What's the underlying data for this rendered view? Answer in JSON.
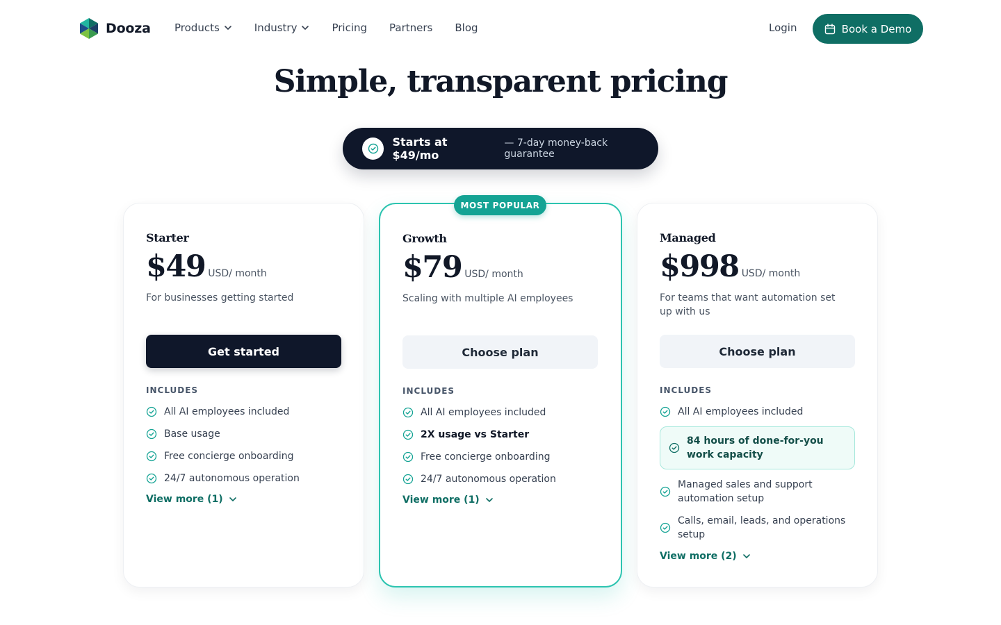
{
  "nav": {
    "brand": "Dooza",
    "links": [
      {
        "label": "Products",
        "dropdown": true
      },
      {
        "label": "Industry",
        "dropdown": true
      },
      {
        "label": "Pricing",
        "dropdown": false
      },
      {
        "label": "Partners",
        "dropdown": false
      },
      {
        "label": "Blog",
        "dropdown": false
      }
    ],
    "login": "Login",
    "demo": "Book a Demo"
  },
  "hero": {
    "title": "Simple, transparent pricing",
    "pill_main": "Starts at $49/mo",
    "pill_sub": "— 7-day money-back guarantee"
  },
  "badge": "MOST POPULAR",
  "includes_label": "INCLUDES",
  "plans": [
    {
      "name": "Starter",
      "price": "$49",
      "per": "USD/ month",
      "desc": "For businesses getting started",
      "cta": "Get started",
      "features": [
        "All AI employees included",
        "Base usage",
        "Free concierge onboarding",
        "24/7 autonomous operation"
      ],
      "view_more": "View more (1)"
    },
    {
      "name": "Growth",
      "price": "$79",
      "per": "USD/ month",
      "desc": "Scaling with multiple AI employees",
      "cta": "Choose plan",
      "features": [
        "All AI employees included",
        "2X usage vs Starter",
        "Free concierge onboarding",
        "24/7 autonomous operation"
      ],
      "view_more": "View more (1)"
    },
    {
      "name": "Managed",
      "price": "$998",
      "per": "USD/ month",
      "desc": "For teams that want automation set up with us",
      "cta": "Choose plan",
      "features": [
        "All AI employees included",
        "84 hours of done-for-you work capacity",
        "Managed sales and support automation setup",
        "Calls, email, leads, and operations setup"
      ],
      "view_more": "View more (2)"
    }
  ],
  "colors": {
    "accent": "#0f6e64",
    "teal": "#14a394",
    "dark": "#0f172a"
  }
}
